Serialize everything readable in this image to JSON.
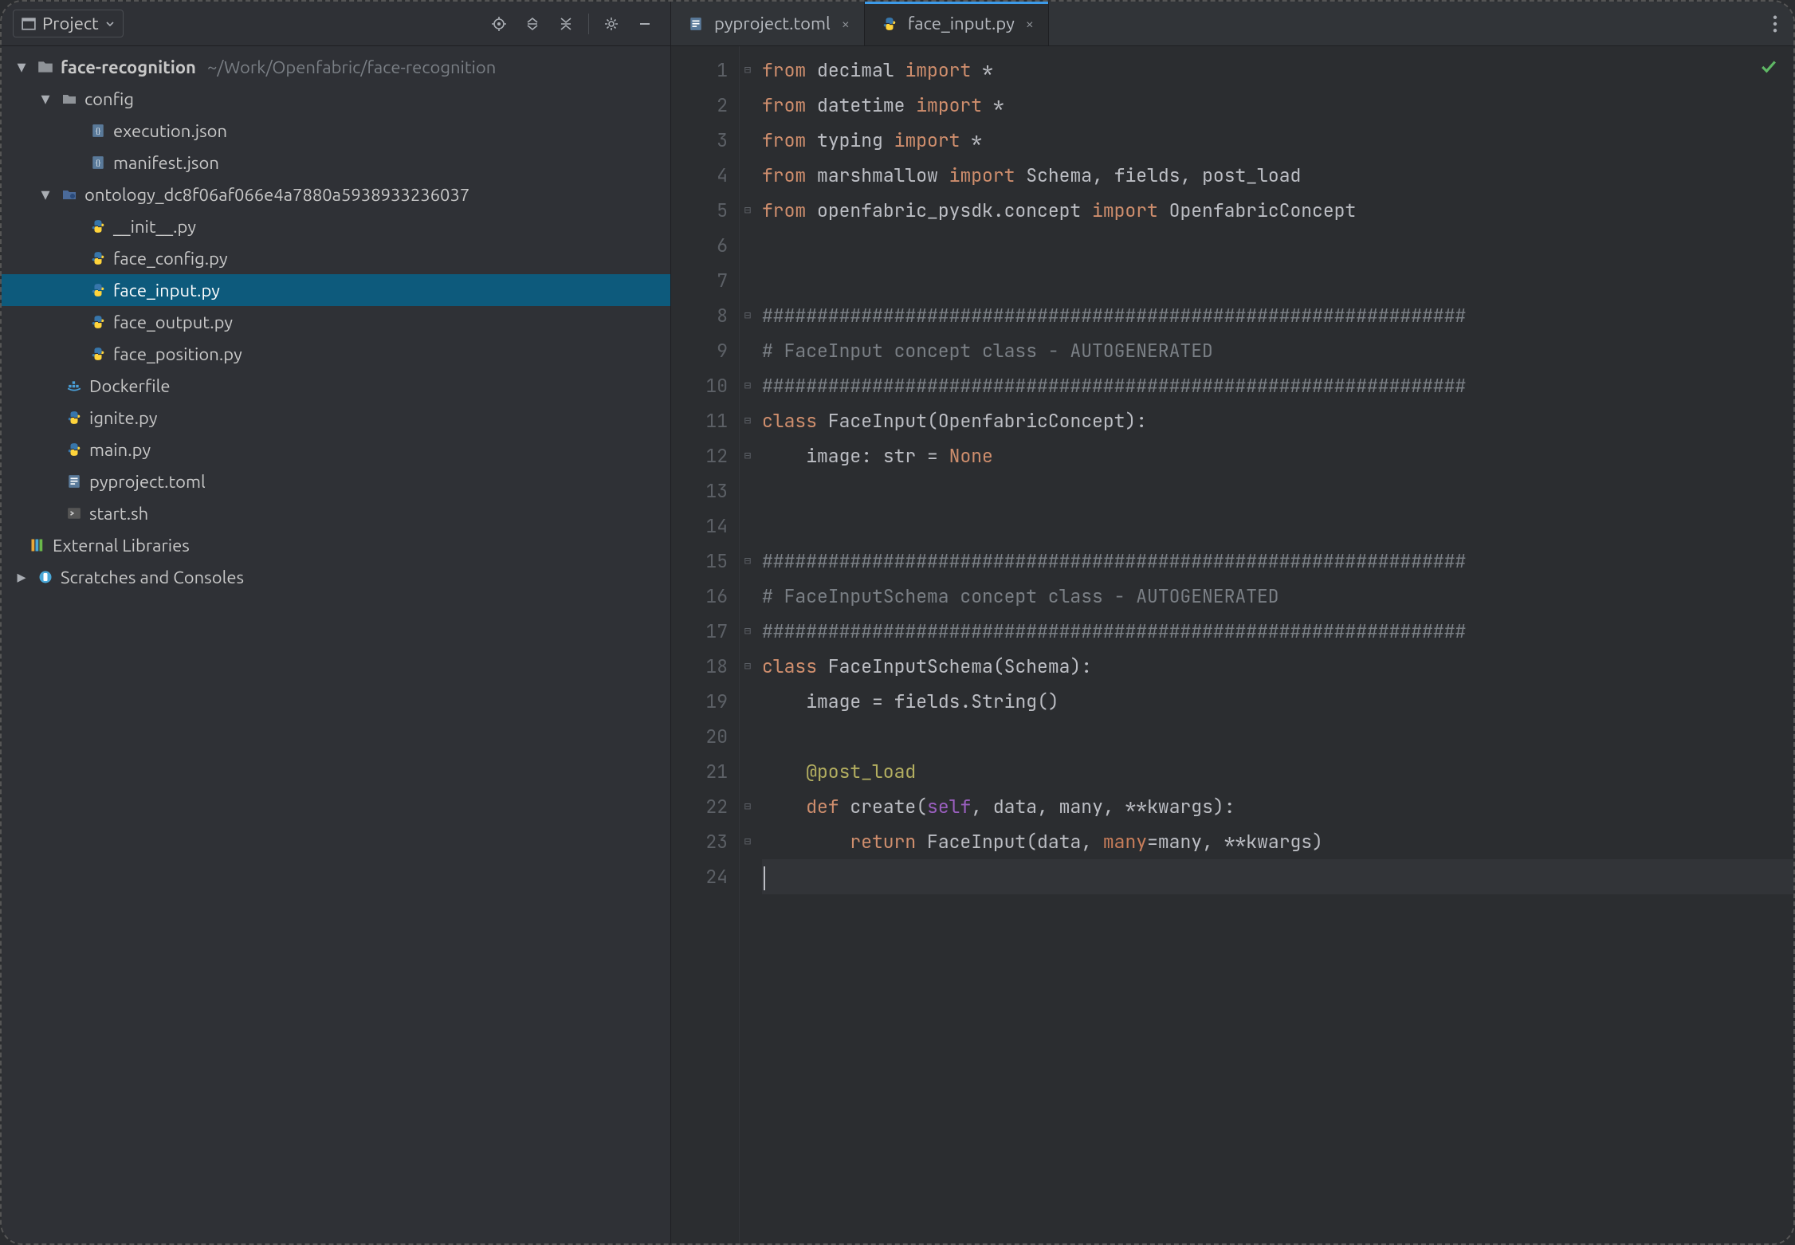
{
  "sidebar": {
    "selector_label": "Project",
    "root": {
      "name": "face-recognition",
      "path": "~/Work/Openfabric/face-recognition"
    },
    "tree": {
      "config": "config",
      "execution": "execution.json",
      "manifest": "manifest.json",
      "ontology_dir": "ontology_dc8f06af066e4a7880a5938933236037",
      "init_py": "__init__.py",
      "face_config": "face_config.py",
      "face_input": "face_input.py",
      "face_output": "face_output.py",
      "face_position": "face_position.py",
      "dockerfile": "Dockerfile",
      "ignite": "ignite.py",
      "main": "main.py",
      "pyproject": "pyproject.toml",
      "start": "start.sh",
      "ext_lib": "External Libraries",
      "scratches": "Scratches and Consoles"
    }
  },
  "tabs": {
    "pyproject": "pyproject.toml",
    "face_input": "face_input.py"
  },
  "code": {
    "line_count": 24,
    "lines": [
      {
        "t": "import",
        "tokens": [
          "from",
          " ",
          "decimal",
          " ",
          "import",
          " ",
          "*"
        ]
      },
      {
        "t": "import",
        "tokens": [
          "from",
          " ",
          "datetime",
          " ",
          "import",
          " ",
          "*"
        ]
      },
      {
        "t": "import",
        "tokens": [
          "from",
          " ",
          "typing",
          " ",
          "import",
          " ",
          "*"
        ]
      },
      {
        "t": "import",
        "tokens": [
          "from",
          " ",
          "marshmallow",
          " ",
          "import",
          " ",
          "Schema",
          ", ",
          "fields",
          ", ",
          "post_load"
        ]
      },
      {
        "t": "import",
        "tokens": [
          "from",
          " ",
          "openfabric_pysdk.concept",
          " ",
          "import",
          " ",
          "OpenfabricConcept"
        ]
      },
      {
        "t": "blank"
      },
      {
        "t": "blank"
      },
      {
        "t": "cmt",
        "text": "################################################################"
      },
      {
        "t": "cmt",
        "text": "# FaceInput concept class - AUTOGENERATED"
      },
      {
        "t": "cmt",
        "text": "################################################################"
      },
      {
        "t": "class",
        "tokens": [
          "class",
          " ",
          "FaceInput",
          "(",
          "OpenfabricConcept",
          "):"
        ]
      },
      {
        "t": "body",
        "tokens": [
          "    ",
          "image",
          ": ",
          "str",
          " = ",
          "None"
        ]
      },
      {
        "t": "blank"
      },
      {
        "t": "blank"
      },
      {
        "t": "cmt",
        "text": "################################################################"
      },
      {
        "t": "cmt",
        "text": "# FaceInputSchema concept class - AUTOGENERATED"
      },
      {
        "t": "cmt",
        "text": "################################################################"
      },
      {
        "t": "class",
        "tokens": [
          "class",
          " ",
          "FaceInputSchema",
          "(",
          "Schema",
          "):"
        ]
      },
      {
        "t": "body",
        "tokens": [
          "    ",
          "image",
          " = ",
          "fields",
          ".",
          "String",
          "()"
        ]
      },
      {
        "t": "blank"
      },
      {
        "t": "decor",
        "tokens": [
          "    ",
          "@post_load"
        ]
      },
      {
        "t": "def",
        "tokens": [
          "    ",
          "def",
          " ",
          "create",
          "(",
          "self",
          ", ",
          "data",
          ", ",
          "many",
          ", ",
          "**",
          "kwargs",
          "):"
        ]
      },
      {
        "t": "ret",
        "tokens": [
          "        ",
          "return",
          " ",
          "FaceInput",
          "(",
          "data",
          ", ",
          "many",
          "=",
          "many",
          ", ",
          "**",
          "kwargs",
          ")"
        ]
      },
      {
        "t": "current"
      }
    ]
  }
}
